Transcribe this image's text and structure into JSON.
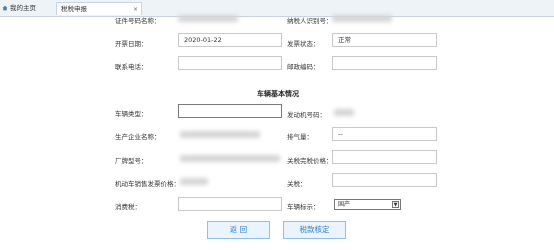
{
  "tabs": {
    "home_label": "我的主页",
    "active_label": "税税申报",
    "close_glyph": "×"
  },
  "form": {
    "top_left_label": "证件号码名称：",
    "top_right_label": "纳税人识别号：",
    "invoice_date_label": "开票日期：",
    "invoice_date_value": "2020-01-22",
    "invoice_status_label": "发票状态：",
    "invoice_status_value": "正常",
    "phone_label": "联系电话：",
    "postcode_label": "邮政编码："
  },
  "vehicle": {
    "section_title": "车辆基本情况",
    "vehicle_type_label": "车辆类型：",
    "engine_no_label": "发动机号码：",
    "manufacturer_label": "生产企业名称：",
    "displacement_label": "排气量：",
    "displacement_value": "--",
    "model_label": "厂牌型号：",
    "tax_price_label": "关税完税价格：",
    "invoice_price_label": "机动车销售发票价格：",
    "customs_duty_label": "关税：",
    "consumption_tax_label": "消费税：",
    "vehicle_flag_label": "车辆标示：",
    "vehicle_flag_value": "国产"
  },
  "buttons": {
    "back_label": "返 回",
    "confirm_label": "税款核定"
  }
}
